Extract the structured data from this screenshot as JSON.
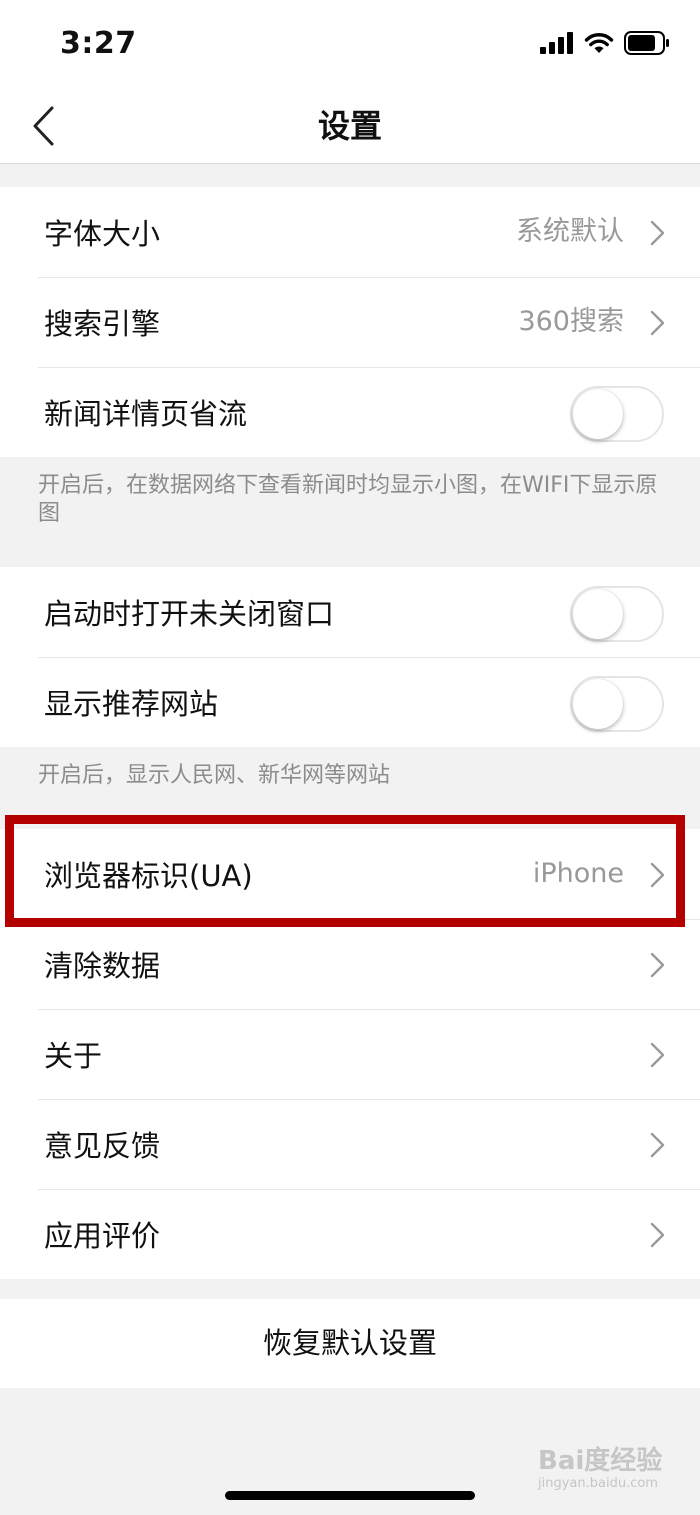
{
  "status_bar": {
    "time": "3:27"
  },
  "nav": {
    "title": "设置"
  },
  "group1": {
    "font_size": {
      "label": "字体大小",
      "value": "系统默认"
    },
    "search_engine": {
      "label": "搜索引擎",
      "value": "360搜索"
    },
    "data_saver": {
      "label": "新闻详情页省流",
      "enabled": false
    }
  },
  "note1": "开启后，在数据网络下查看新闻时均显示小图，在WIFI下显示原图",
  "group2": {
    "restore_windows": {
      "label": "启动时打开未关闭窗口",
      "enabled": false
    },
    "recommended_sites": {
      "label": "显示推荐网站",
      "enabled": false
    }
  },
  "note2": "开启后，显示人民网、新华网等网站",
  "group3": {
    "user_agent": {
      "label": "浏览器标识(UA)",
      "value": "iPhone"
    },
    "clear_data": {
      "label": "清除数据"
    },
    "about": {
      "label": "关于"
    },
    "feedback": {
      "label": "意见反馈"
    },
    "rate_app": {
      "label": "应用评价"
    }
  },
  "reset_button": "恢复默认设置",
  "watermark": {
    "text": "Bai度经验",
    "sub": "jingyan.baidu.com"
  },
  "colors": {
    "highlight": "#b50000",
    "secondary_text": "#999999",
    "background": "#f2f2f2"
  }
}
